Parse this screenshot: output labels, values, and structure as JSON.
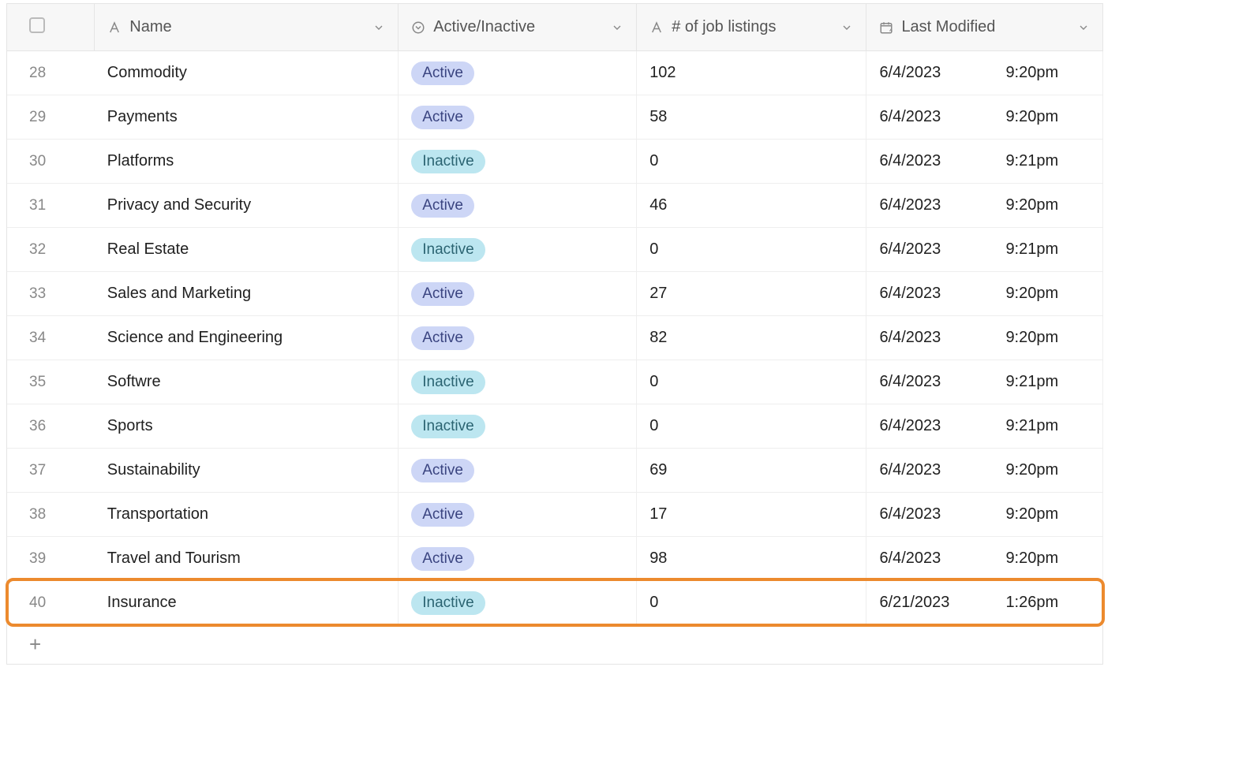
{
  "columns": {
    "name": "Name",
    "status": "Active/Inactive",
    "jobs": "# of job listings",
    "modified": "Last Modified"
  },
  "rows": [
    {
      "num": "28",
      "name": "Commodity",
      "status": "Active",
      "jobs": "102",
      "date": "6/4/2023",
      "time": "9:20pm"
    },
    {
      "num": "29",
      "name": "Payments",
      "status": "Active",
      "jobs": "58",
      "date": "6/4/2023",
      "time": "9:20pm"
    },
    {
      "num": "30",
      "name": "Platforms",
      "status": "Inactive",
      "jobs": "0",
      "date": "6/4/2023",
      "time": "9:21pm"
    },
    {
      "num": "31",
      "name": "Privacy and Security",
      "status": "Active",
      "jobs": "46",
      "date": "6/4/2023",
      "time": "9:20pm"
    },
    {
      "num": "32",
      "name": "Real Estate",
      "status": "Inactive",
      "jobs": "0",
      "date": "6/4/2023",
      "time": "9:21pm"
    },
    {
      "num": "33",
      "name": "Sales and Marketing",
      "status": "Active",
      "jobs": "27",
      "date": "6/4/2023",
      "time": "9:20pm"
    },
    {
      "num": "34",
      "name": "Science and Engineering",
      "status": "Active",
      "jobs": "82",
      "date": "6/4/2023",
      "time": "9:20pm"
    },
    {
      "num": "35",
      "name": "Softwre",
      "status": "Inactive",
      "jobs": "0",
      "date": "6/4/2023",
      "time": "9:21pm"
    },
    {
      "num": "36",
      "name": "Sports",
      "status": "Inactive",
      "jobs": "0",
      "date": "6/4/2023",
      "time": "9:21pm"
    },
    {
      "num": "37",
      "name": "Sustainability",
      "status": "Active",
      "jobs": "69",
      "date": "6/4/2023",
      "time": "9:20pm"
    },
    {
      "num": "38",
      "name": "Transportation",
      "status": "Active",
      "jobs": "17",
      "date": "6/4/2023",
      "time": "9:20pm"
    },
    {
      "num": "39",
      "name": "Travel and Tourism",
      "status": "Active",
      "jobs": "98",
      "date": "6/4/2023",
      "time": "9:20pm"
    },
    {
      "num": "40",
      "name": "Insurance",
      "status": "Inactive",
      "jobs": "0",
      "date": "6/21/2023",
      "time": "1:26pm",
      "highlighted": true
    }
  ],
  "add_label": "+"
}
